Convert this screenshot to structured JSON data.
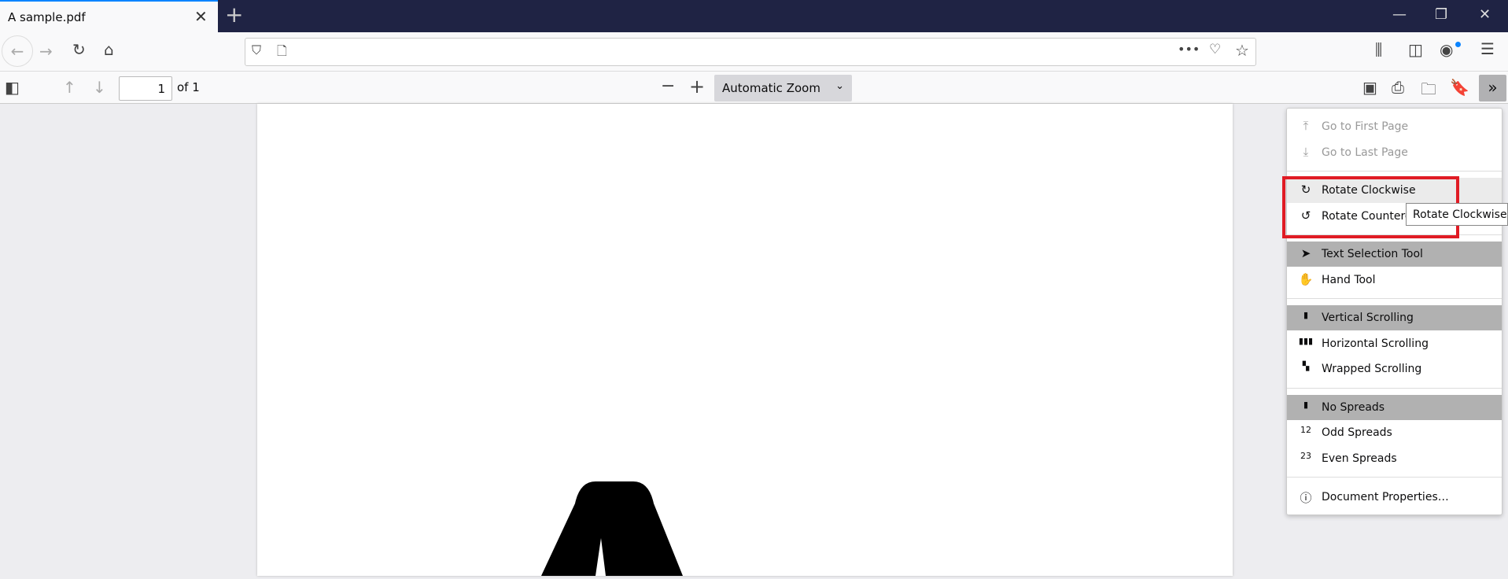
{
  "tab": {
    "title": "A sample.pdf"
  },
  "toolbar": {
    "page_number": "1",
    "page_count": "of 1",
    "zoom": "Automatic Zoom"
  },
  "menu": {
    "items": [
      {
        "label": "Go to First Page",
        "icon": "first-page-icon",
        "disabled": true
      },
      {
        "label": "Go to Last Page",
        "icon": "last-page-icon",
        "disabled": true
      },
      {
        "label": "Rotate Clockwise",
        "icon": "rotate-cw-icon"
      },
      {
        "label": "Rotate Counterclockwise",
        "icon": "rotate-ccw-icon"
      },
      {
        "label": "Text Selection Tool",
        "icon": "cursor-icon",
        "selected": true
      },
      {
        "label": "Hand Tool",
        "icon": "hand-icon"
      },
      {
        "label": "Vertical Scrolling",
        "icon": "vertical-scroll-icon",
        "selected": true
      },
      {
        "label": "Horizontal Scrolling",
        "icon": "horizontal-scroll-icon"
      },
      {
        "label": "Wrapped Scrolling",
        "icon": "wrapped-scroll-icon"
      },
      {
        "label": "No Spreads",
        "icon": "no-spreads-icon",
        "selected": true
      },
      {
        "label": "Odd Spreads",
        "icon": "odd-spreads-icon"
      },
      {
        "label": "Even Spreads",
        "icon": "even-spreads-icon"
      },
      {
        "label": "Document Properties…",
        "icon": "info-icon"
      }
    ]
  },
  "tooltip": "Rotate Clockwise",
  "colors": {
    "accent": "#0a84ff",
    "highlight": "#e01b24",
    "titlebar": "#1f2344"
  }
}
